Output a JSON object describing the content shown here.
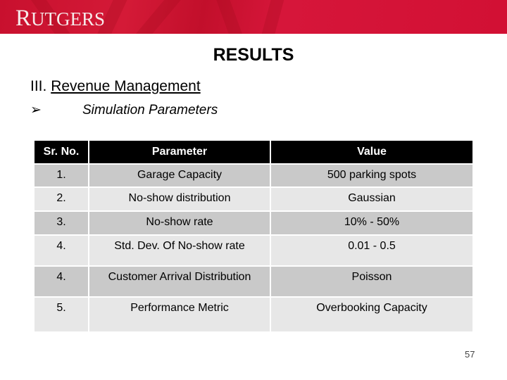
{
  "header": {
    "logo_cap": "R",
    "logo_rest": "UTGERS"
  },
  "slide": {
    "title": "RESULTS",
    "section_number": "III.",
    "section_title": "Revenue Management",
    "bullet_icon": "arrowhead-bullet",
    "bullet_glyph": "➢",
    "bullet_text": "Simulation Parameters"
  },
  "table": {
    "headers": [
      "Sr. No.",
      "Parameter",
      "Value"
    ],
    "rows": [
      [
        "1.",
        "Garage Capacity",
        "500 parking spots"
      ],
      [
        "2.",
        "No-show distribution",
        "Gaussian"
      ],
      [
        "3.",
        "No-show rate",
        "10% - 50%"
      ],
      [
        "4.",
        "Std. Dev. Of No-show rate",
        "0.01 - 0.5"
      ],
      [
        "4.",
        "Customer Arrival Distribution",
        "Poisson"
      ],
      [
        "5.",
        "Performance Metric",
        "Overbooking Capacity"
      ]
    ]
  },
  "colors": {
    "brand_red": "#d21034",
    "header_bg": "#000000",
    "row_dark": "#c9c9c9",
    "row_light": "#e7e7e7"
  },
  "page_number": "57"
}
